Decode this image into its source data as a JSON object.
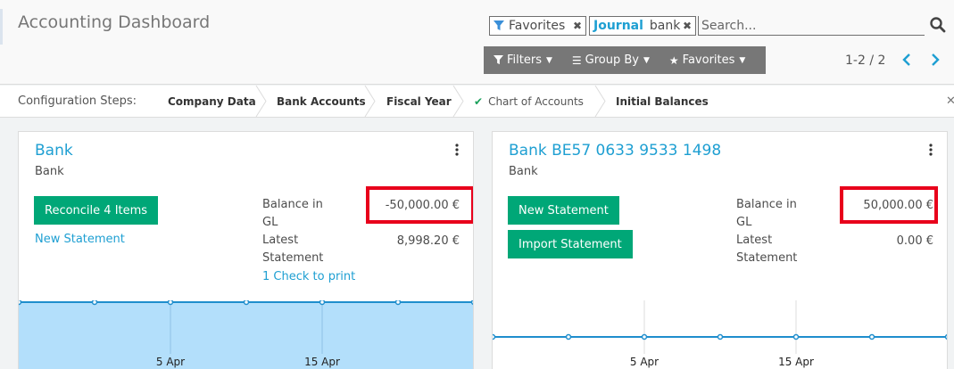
{
  "header": {
    "title": "Accounting Dashboard"
  },
  "search": {
    "facet_favorites": "Favorites",
    "facet_journal_label": "Journal",
    "facet_journal_value": "bank",
    "placeholder": "Search..."
  },
  "filter_bar": {
    "filters": "Filters",
    "group_by": "Group By",
    "favorites": "Favorites"
  },
  "pager": {
    "value": "1-2 / 2"
  },
  "config_steps": {
    "label": "Configuration Steps:",
    "steps": [
      {
        "label": "Company Data",
        "done": false
      },
      {
        "label": "Bank Accounts",
        "done": false
      },
      {
        "label": "Fiscal Year",
        "done": false
      },
      {
        "label": "Chart of Accounts",
        "done": true
      },
      {
        "label": "Initial Balances",
        "done": false
      }
    ]
  },
  "cards": [
    {
      "title": "Bank",
      "subtitle": "Bank",
      "buttons": [
        "Reconcile 4 Items"
      ],
      "link": "New Statement",
      "balance_label_1": "Balance in",
      "balance_label_2": "GL",
      "balance_value": "-50,000.00 €",
      "latest_label_1": "Latest",
      "latest_label_2": "Statement",
      "latest_value": "8,998.20 €",
      "checks_link": "1 Check to print",
      "graph": {
        "x_labels": [
          "5 Apr",
          "15 Apr"
        ],
        "fill": "#b3dffb"
      }
    },
    {
      "title": "Bank BE57 0633 9533 1498",
      "subtitle": "Bank",
      "buttons": [
        "New Statement",
        "Import Statement"
      ],
      "balance_label_1": "Balance in",
      "balance_label_2": "GL",
      "balance_value": "50,000.00 €",
      "latest_label_1": "Latest",
      "latest_label_2": "Statement",
      "latest_value": "0.00 €",
      "graph": {
        "x_labels": [
          "5 Apr",
          "15 Apr"
        ],
        "fill": "none"
      }
    }
  ],
  "colors": {
    "accent": "#1e9fd2",
    "button": "#00a777",
    "highlight": "#e8001b",
    "filter_bar": "#777777"
  }
}
